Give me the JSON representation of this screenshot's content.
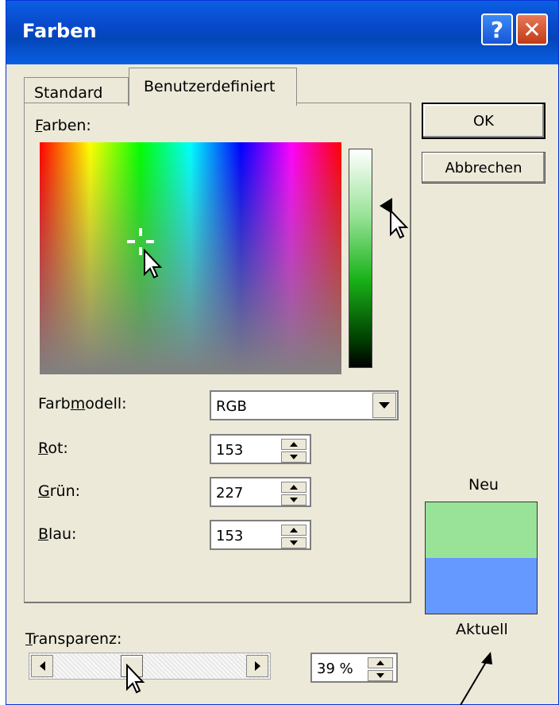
{
  "window": {
    "title": "Farben",
    "help_glyph": "?",
    "close_glyph": "✕"
  },
  "tabs": [
    {
      "label": "Standard",
      "active": false
    },
    {
      "label": "Benutzerdefiniert",
      "active": true
    }
  ],
  "colors_section": {
    "label_prefix": "F",
    "label_rest": "arben:"
  },
  "luminance": {
    "level": 0.26
  },
  "model": {
    "label_a": "Farb",
    "label_u": "m",
    "label_b": "odell:",
    "value": "RGB"
  },
  "red": {
    "label_u": "R",
    "label_rest": "ot:",
    "value": "153"
  },
  "green": {
    "label_u": "G",
    "label_rest": "rün:",
    "value": "227"
  },
  "blue": {
    "label_u": "B",
    "label_rest": "lau:",
    "value": "153"
  },
  "buttons": {
    "ok": "OK",
    "cancel": "Abbrechen"
  },
  "preview": {
    "new_label": "Neu",
    "current_label": "Aktuell",
    "new_color": "#99e399",
    "current_color": "#6699ff"
  },
  "transparency": {
    "label_u": "T",
    "label_rest": "ransparenz:",
    "value": "39 %",
    "level": 0.39
  }
}
